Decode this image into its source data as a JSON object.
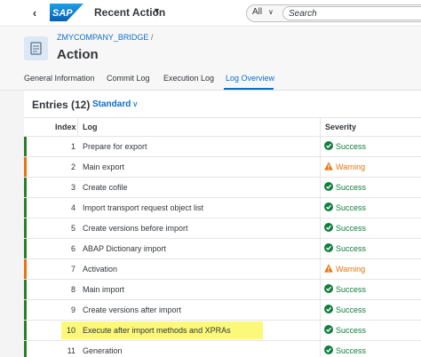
{
  "shell": {
    "back_icon": "chevron-left-icon",
    "logo_text": "SAP",
    "app_title": "Recent Action",
    "search_scope": "All",
    "search_placeholder": "Search"
  },
  "header": {
    "breadcrumb": "ZMYCOMPANY_BRIDGE",
    "breadcrumb_sep": "/",
    "title": "Action"
  },
  "tabs": [
    {
      "label": "General Information",
      "active": false
    },
    {
      "label": "Commit Log",
      "active": false
    },
    {
      "label": "Execution Log",
      "active": false
    },
    {
      "label": "Log Overview",
      "active": true
    }
  ],
  "table": {
    "title": "Entries (12)",
    "variant": "Standard",
    "columns": {
      "index": "Index",
      "log": "Log",
      "severity": "Severity"
    },
    "rows": [
      {
        "index": "1",
        "log": "Prepare for export",
        "severity": "Success",
        "status": "success"
      },
      {
        "index": "2",
        "log": "Main export",
        "severity": "Warning",
        "status": "warning"
      },
      {
        "index": "3",
        "log": "Create cofile",
        "severity": "Success",
        "status": "success"
      },
      {
        "index": "4",
        "log": "Import transport request object list",
        "severity": "Success",
        "status": "success"
      },
      {
        "index": "5",
        "log": "Create versions before import",
        "severity": "Success",
        "status": "success"
      },
      {
        "index": "6",
        "log": "ABAP Dictionary import",
        "severity": "Success",
        "status": "success"
      },
      {
        "index": "7",
        "log": "Activation",
        "severity": "Warning",
        "status": "warning"
      },
      {
        "index": "8",
        "log": "Main import",
        "severity": "Success",
        "status": "success"
      },
      {
        "index": "9",
        "log": "Create versions after import",
        "severity": "Success",
        "status": "success"
      },
      {
        "index": "10",
        "log": "Execute after import methods and XPRAs",
        "severity": "Success",
        "status": "success",
        "highlighted": true
      },
      {
        "index": "11",
        "log": "Generation",
        "severity": "Success",
        "status": "success"
      }
    ]
  },
  "colors": {
    "accent": "#0a6ed1",
    "success": "#107e3e",
    "warning": "#e9730c",
    "highlight": "#fbf87a"
  }
}
